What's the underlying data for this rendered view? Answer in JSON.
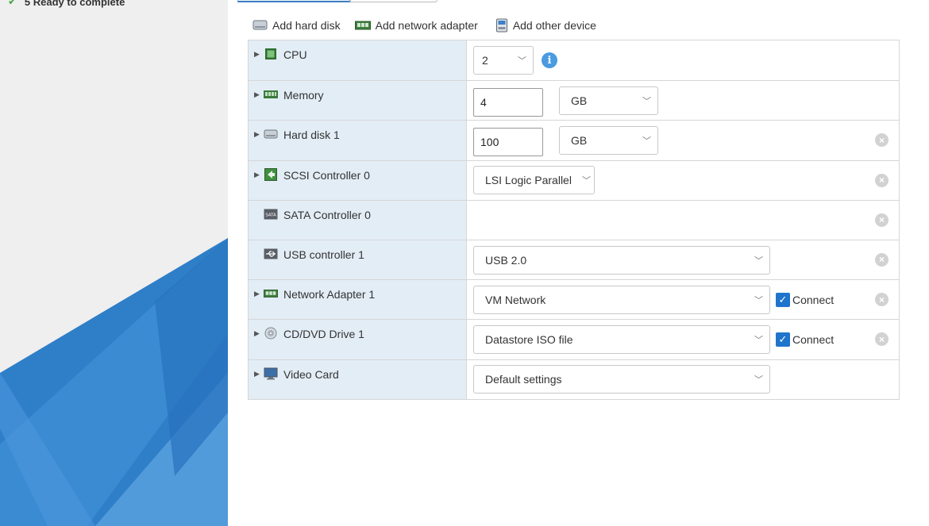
{
  "wizard": {
    "current_step": "5 Ready to complete"
  },
  "toolbar": {
    "add_hard_disk": "Add hard disk",
    "add_network_adapter": "Add network adapter",
    "add_other_device": "Add other device"
  },
  "devices": {
    "cpu": {
      "label": "CPU",
      "value": "2"
    },
    "memory": {
      "label": "Memory",
      "value": "4",
      "unit": "GB"
    },
    "hard_disk": {
      "label": "Hard disk 1",
      "value": "100",
      "unit": "GB"
    },
    "scsi": {
      "label": "SCSI Controller 0",
      "value": "LSI Logic Parallel"
    },
    "sata": {
      "label": "SATA Controller 0"
    },
    "usb": {
      "label": "USB controller 1",
      "value": "USB 2.0"
    },
    "network": {
      "label": "Network Adapter 1",
      "value": "VM Network",
      "connect": "Connect"
    },
    "cddvd": {
      "label": "CD/DVD Drive 1",
      "value": "Datastore ISO file",
      "connect": "Connect"
    },
    "video": {
      "label": "Video Card",
      "value": "Default settings"
    }
  },
  "colors": {
    "label_bg": "#e3edf6",
    "accent": "#1f74cc",
    "sidebar_bg": "#efefef"
  }
}
